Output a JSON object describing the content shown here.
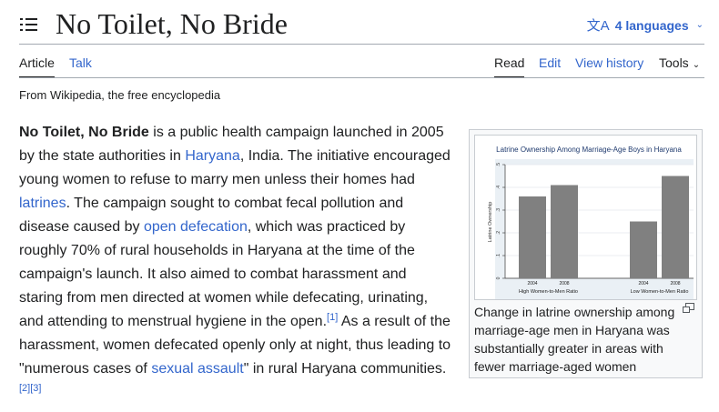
{
  "header": {
    "title": "No Toilet, No Bride",
    "languages_label": "4 languages",
    "languages_icon": "translate-icon"
  },
  "tabs": {
    "article": "Article",
    "talk": "Talk",
    "read": "Read",
    "edit": "Edit",
    "view_history": "View history",
    "tools": "Tools"
  },
  "tagline": "From Wikipedia, the free encyclopedia",
  "article": {
    "bold_title": "No Toilet, No Bride",
    "t1": " is a public health campaign launched in 2005 by the state authorities in ",
    "link_haryana": "Haryana",
    "t2": ", India. The initiative encouraged young women to refuse to marry men unless their homes had ",
    "link_latrines": "latrines",
    "t3": ". The campaign sought to combat fecal pollution and disease caused by ",
    "link_open_defecation": "open defecation",
    "t4": ", which was practiced by roughly 70% of rural households in Haryana at the time of the campaign's launch. It also aimed to combat harassment and staring from men directed at women while defecating, urinating, and attending to menstrual hygiene in the open.",
    "ref1": "[1]",
    "t5": " As a result of the harassment, women defecated openly only at night, thus leading to \"numerous cases of ",
    "link_sexual_assault": "sexual assault",
    "t6": "\" in rural Haryana communities.",
    "ref2": "[2]",
    "ref3": "[3]"
  },
  "figure": {
    "caption": "Change in latrine ownership among marriage-age men in Haryana was substantially greater in areas with fewer marriage-aged women"
  },
  "colors": {
    "link": "#3366cc",
    "text": "#202122",
    "chart_title": "#1f3a6e",
    "bar": "#808080"
  },
  "chart_data": {
    "type": "bar",
    "title": "Latrine Ownership Among Marriage-Age Boys in Haryana",
    "ylabel": "Latrine Ownership",
    "ylim": [
      0,
      0.5
    ],
    "yticks": [
      "0",
      ".1",
      ".2",
      ".3",
      ".4",
      ".5"
    ],
    "groups": [
      {
        "label": "High Women-to-Men Ratio",
        "bars": [
          {
            "label": "2004",
            "value": 0.36
          },
          {
            "label": "2008",
            "value": 0.41
          }
        ]
      },
      {
        "label": "Low Women-to-Men Ratio",
        "bars": [
          {
            "label": "2004",
            "value": 0.25
          },
          {
            "label": "2008",
            "value": 0.45
          }
        ]
      }
    ],
    "grid": true
  }
}
